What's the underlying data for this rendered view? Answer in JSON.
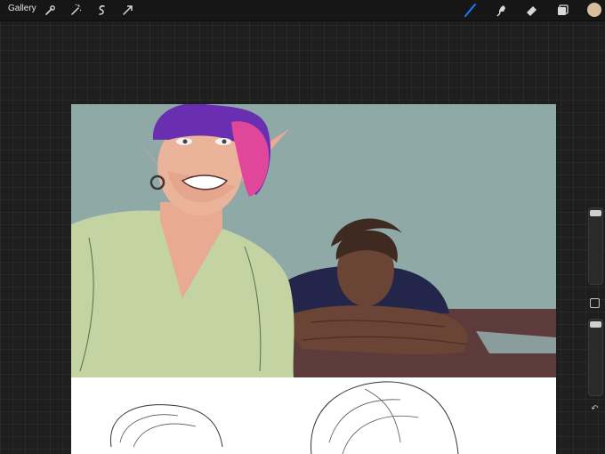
{
  "toolbar": {
    "gallery_label": "Gallery",
    "left_tools": [
      "wrench-icon",
      "magic-wand-icon",
      "selection-s-icon",
      "transform-arrow-icon"
    ],
    "right_tools": [
      "brush-icon",
      "smudge-icon",
      "eraser-icon",
      "layers-icon"
    ],
    "active_tool": "brush",
    "active_color": "#d9bd9f"
  },
  "sidebar": {
    "brush_size_level": 0.03,
    "brush_opacity_level": 0.03,
    "modify_icon": "square-icon",
    "undo_icon": "undo-arrow-icon"
  },
  "colors": {
    "accent": "#1e78ff",
    "canvas_background": "#8fa9a7",
    "shirt_green": "#c3d4a2",
    "table": "#5e3b3b",
    "hair_purple": "#6a2fb0",
    "hair_pink": "#e0479a"
  }
}
